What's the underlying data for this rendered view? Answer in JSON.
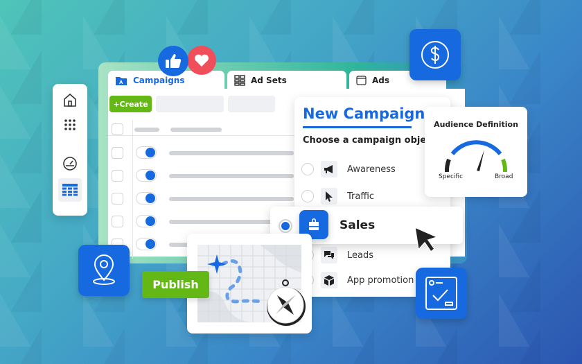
{
  "tabs": [
    {
      "label": "Campaigns",
      "icon": "campaign-folder-icon",
      "active": true
    },
    {
      "label": "Ad Sets",
      "icon": "grid-icon",
      "active": false
    },
    {
      "label": "Ads",
      "icon": "window-icon",
      "active": false
    }
  ],
  "toolbar": {
    "create_label": "+Create"
  },
  "sidebar": {
    "items": [
      {
        "icon": "home-icon"
      },
      {
        "icon": "apps-icon"
      },
      {
        "icon": "dashboard-gauge-icon"
      },
      {
        "icon": "table-icon",
        "active": true
      }
    ]
  },
  "campaign_rows": 5,
  "new_campaign": {
    "title": "New Campaign",
    "subtitle": "Choose a campaign objecti",
    "objectives": [
      {
        "label": "Awareness",
        "icon": "megaphone-icon"
      },
      {
        "label": "Traffic",
        "icon": "cursor-icon"
      },
      {
        "label": "Sales",
        "icon": "shopping-bag-icon",
        "selected": true
      },
      {
        "label": "Leads",
        "icon": "chat-icon"
      },
      {
        "label": "App promotion",
        "icon": "cube-icon"
      }
    ]
  },
  "audience": {
    "title": "Audience Definition",
    "left_label": "Specific",
    "right_label": "Broad"
  },
  "publish": {
    "label": "Publish"
  },
  "colors": {
    "accent": "#1769e0",
    "green": "#64b816",
    "heart": "#ef4f5a"
  }
}
